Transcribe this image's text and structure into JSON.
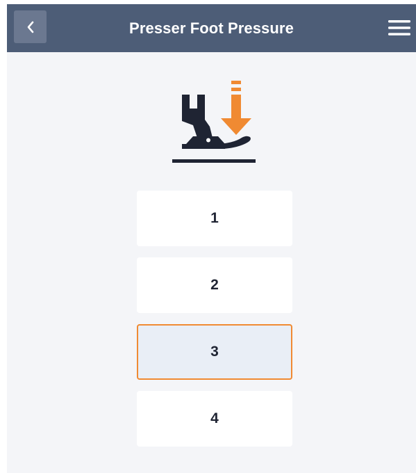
{
  "header": {
    "title": "Presser Foot Pressure",
    "back_icon": "chevron-left-icon",
    "menu_icon": "hamburger-menu-icon",
    "background_color": "#4d5d77"
  },
  "illustration": {
    "icon": "presser-foot-pressure-icon",
    "arrow_color": "#f08a32",
    "foot_color": "#1f2433"
  },
  "pressure_options": [
    {
      "label": "1",
      "selected": false
    },
    {
      "label": "2",
      "selected": false
    },
    {
      "label": "3",
      "selected": true
    },
    {
      "label": "4",
      "selected": false
    }
  ],
  "selected_value": "3",
  "accent_color": "#f08a32"
}
